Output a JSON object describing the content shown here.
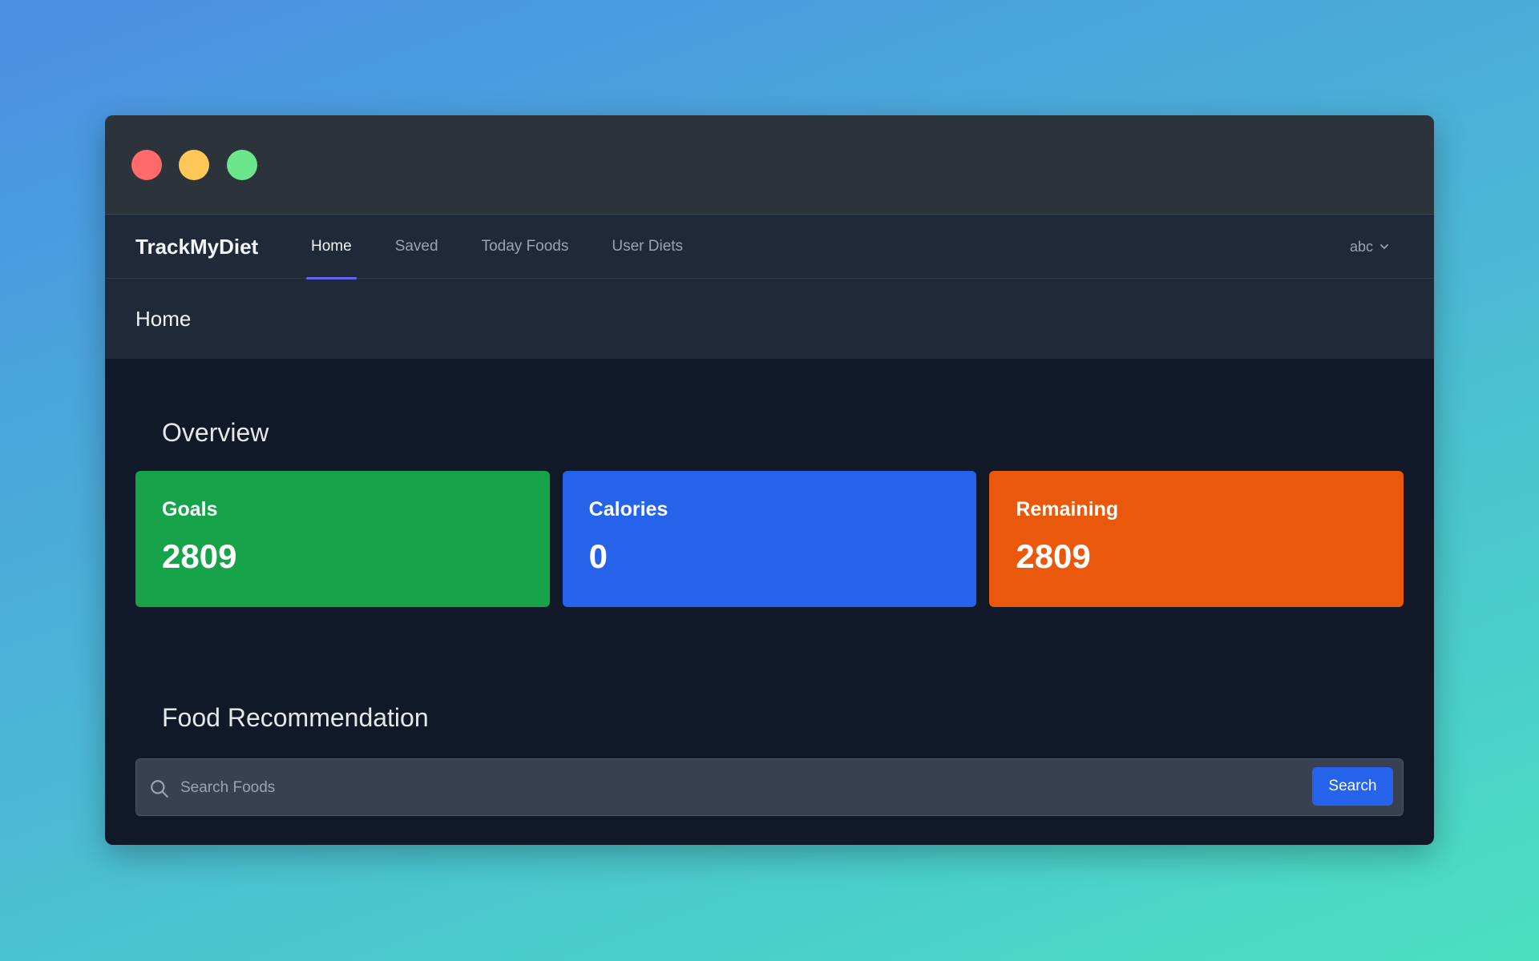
{
  "nav": {
    "brand": "TrackMyDiet",
    "links": [
      {
        "label": "Home",
        "active": true
      },
      {
        "label": "Saved",
        "active": false
      },
      {
        "label": "Today Foods",
        "active": false
      },
      {
        "label": "User Diets",
        "active": false
      }
    ],
    "user": "abc",
    "user_icon": "chevron-down-icon"
  },
  "page": {
    "title": "Home"
  },
  "overview": {
    "title": "Overview",
    "cards": [
      {
        "label": "Goals",
        "value": "2809",
        "color": "#16a34a"
      },
      {
        "label": "Calories",
        "value": "0",
        "color": "#2563eb"
      },
      {
        "label": "Remaining",
        "value": "2809",
        "color": "#ea580c"
      }
    ]
  },
  "recommendation": {
    "title": "Food Recommendation",
    "search_placeholder": "Search Foods",
    "search_value": "",
    "search_icon": "search-icon",
    "button_label": "Search"
  },
  "colors": {
    "window_titlebar": "#2d333b",
    "navbar": "#1f2937",
    "content_bg": "#111827",
    "active_tab_indicator": "#6366f1",
    "traffic_red": "#ff6b6b",
    "traffic_yellow": "#ffc658",
    "traffic_green": "#6ce68c"
  }
}
